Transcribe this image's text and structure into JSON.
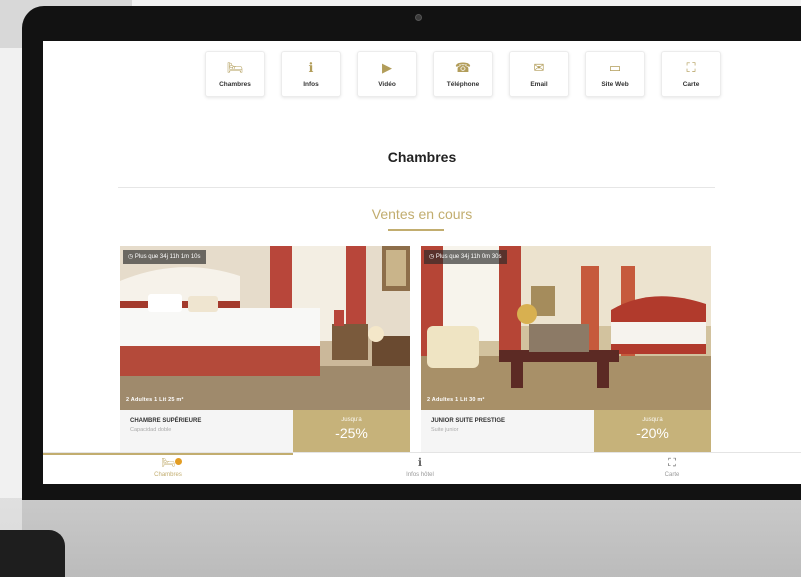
{
  "colors": {
    "accent_gold": "#c2ad6f",
    "price_block": "#c6b27a",
    "badge": "#e39d24"
  },
  "nav_buttons": [
    {
      "label": "Chambres",
      "icon": "bed-icon",
      "glyph": "🛏"
    },
    {
      "label": "Infos",
      "icon": "info-icon",
      "glyph": "ℹ"
    },
    {
      "label": "Vidéo",
      "icon": "play-icon",
      "glyph": "▶"
    },
    {
      "label": "Téléphone",
      "icon": "phone-icon",
      "glyph": "☎"
    },
    {
      "label": "Email",
      "icon": "email-icon",
      "glyph": "✉"
    },
    {
      "label": "Site Web",
      "icon": "browser-icon",
      "glyph": "▭"
    },
    {
      "label": "Carte",
      "icon": "map-icon",
      "glyph": "⛶"
    }
  ],
  "section_title": "Chambres",
  "subtitle": "Ventes en cours",
  "cards": [
    {
      "timer": "Plus que 34j 11h 1m 10s",
      "meta": "2 Adultes   1 Lit   25 m²",
      "name": "CHAMBRE SUPÉRIEURE",
      "desc": "Capacidad doble",
      "upto": "Jusqu'à",
      "discount": "-25%"
    },
    {
      "timer": "Plus que 34j 11h 0m 30s",
      "meta": "2 Adultes   1 Lit   30 m²",
      "name": "JUNIOR SUITE PRESTIGE",
      "desc": "Suite junior",
      "upto": "Jusqu'à",
      "discount": "-20%"
    }
  ],
  "bottom_nav": [
    {
      "label": "Chambres",
      "icon": "bed-icon",
      "glyph": "🛏"
    },
    {
      "label": "Infos hôtel",
      "icon": "info-icon",
      "glyph": "ℹ"
    },
    {
      "label": "Carte",
      "icon": "map-icon",
      "glyph": "⛶"
    }
  ]
}
